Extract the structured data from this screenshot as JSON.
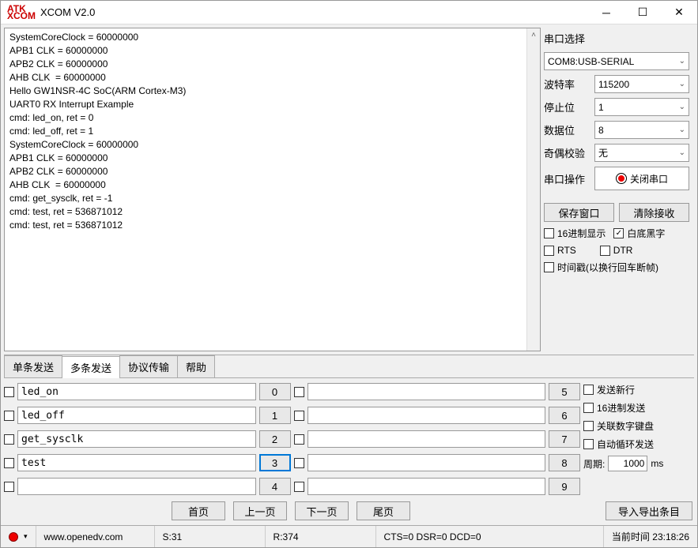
{
  "window": {
    "title": "XCOM V2.0",
    "logo_top": "ATK",
    "logo_bot": "XCOM"
  },
  "terminal_text": "SystemCoreClock = 60000000\nAPB1 CLK = 60000000\nAPB2 CLK = 60000000\nAHB CLK  = 60000000\nHello GW1NSR-4C SoC(ARM Cortex-M3)\nUART0 RX Interrupt Example\ncmd: led_on, ret = 0\ncmd: led_off, ret = 1\nSystemCoreClock = 60000000\nAPB1 CLK = 60000000\nAPB2 CLK = 60000000\nAHB CLK  = 60000000\ncmd: get_sysclk, ret = -1\ncmd: test, ret = 536871012\ncmd: test, ret = 536871012",
  "serial": {
    "section": "串口选择",
    "port": "COM8:USB-SERIAL",
    "baud_lbl": "波特率",
    "baud": "115200",
    "stop_lbl": "停止位",
    "stop": "1",
    "data_lbl": "数据位",
    "data": "8",
    "parity_lbl": "奇偶校验",
    "parity": "无",
    "op_lbl": "串口操作",
    "op_btn": "关闭串口",
    "save_btn": "保存窗口",
    "clear_btn": "清除接收",
    "hex_disp": "16进制显示",
    "white_bg": "白底黑字",
    "rts": "RTS",
    "dtr": "DTR",
    "timestamp": "时间戳(以换行回车断帧)"
  },
  "tabs": {
    "single": "单条发送",
    "multi": "多条发送",
    "proto": "协议传输",
    "help": "帮助"
  },
  "send": {
    "col1": [
      {
        "txt": "led_on",
        "n": "0"
      },
      {
        "txt": "led_off",
        "n": "1"
      },
      {
        "txt": "get_sysclk",
        "n": "2"
      },
      {
        "txt": "test",
        "n": "3"
      },
      {
        "txt": "",
        "n": "4"
      }
    ],
    "col2": [
      {
        "txt": "",
        "n": "5"
      },
      {
        "txt": "",
        "n": "6"
      },
      {
        "txt": "",
        "n": "7"
      },
      {
        "txt": "",
        "n": "8"
      },
      {
        "txt": "",
        "n": "9"
      }
    ],
    "newline": "发送新行",
    "hexsend": "16进制发送",
    "numpad": "关联数字键盘",
    "loop": "自动循环发送",
    "period_lbl": "周期:",
    "period_val": "1000",
    "period_unit": "ms"
  },
  "nav": {
    "first": "首页",
    "prev": "上一页",
    "next": "下一页",
    "last": "尾页",
    "export": "导入导出条目"
  },
  "status": {
    "url": "www.openedv.com",
    "s": "S:31",
    "r": "R:374",
    "signals": "CTS=0 DSR=0 DCD=0",
    "time_lbl": "当前时间",
    "time": "23:18:26"
  }
}
